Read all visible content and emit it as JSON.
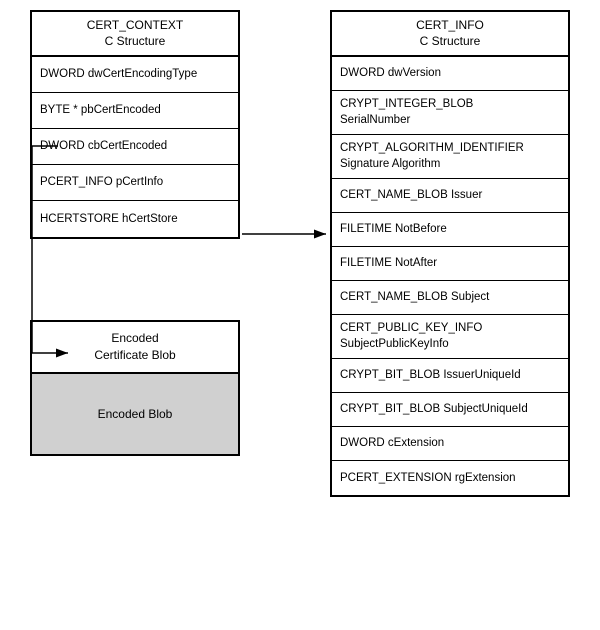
{
  "left": {
    "cert_context": {
      "header_line1": "CERT_CONTEXT",
      "header_line2": "C Structure",
      "rows": [
        "DWORD dwCertEncodingType",
        "BYTE *  pbCertEncoded",
        "DWORD  cbCertEncoded",
        "PCERT_INFO  pCertInfo",
        "HCERTSTORE  hCertStore"
      ]
    },
    "encoded_cert": {
      "header_line1": "Encoded",
      "header_line2": "Certificate Blob",
      "body_label": "Encoded Blob"
    }
  },
  "right": {
    "cert_info": {
      "header_line1": "CERT_INFO",
      "header_line2": "C Structure",
      "rows": [
        "DWORD dwVersion",
        "CRYPT_INTEGER_BLOB\nSerialNumber",
        "CRYPT_ALGORITHM_IDENTIFIER\nSignature Algorithm",
        "CERT_NAME_BLOB Issuer",
        "FILETIME NotBefore",
        "FILETIME NotAfter",
        "CERT_NAME_BLOB Subject",
        "CERT_PUBLIC_KEY_INFO\nSubjectPublicKeyInfo",
        "CRYPT_BIT_BLOB IssuerUniqueId",
        "CRYPT_BIT_BLOB SubjectUniqueId",
        "DWORD cExtension",
        "PCERT_EXTENSION rgExtension"
      ]
    }
  },
  "arrows": {
    "right_arrow_label": "→",
    "down_arrow_label": "↓"
  }
}
